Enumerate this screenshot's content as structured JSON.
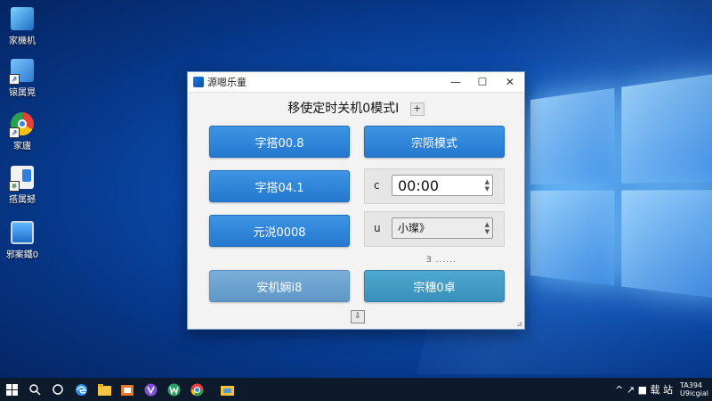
{
  "desktop": {
    "icons": [
      {
        "label": "家機机"
      },
      {
        "label": "锿属晃"
      },
      {
        "label": "家廬"
      },
      {
        "label": "搭属撼"
      },
      {
        "label": "邪案鐵0"
      }
    ]
  },
  "window": {
    "title": "源嗯乐童",
    "controls": {
      "minimize": "—",
      "maximize": "☐",
      "close": "✕"
    },
    "heading": "移使定时关机0模式I",
    "add_label": "+",
    "buttons": {
      "btn1": "字搭00.8",
      "btn2": "宗陨模式",
      "btn3": "字搭04.1",
      "btn4": "元涚0008",
      "btn5": "安机娴i8",
      "btn6": "宗穗0卓"
    },
    "time_field": {
      "label": "c",
      "value": "00:00"
    },
    "mode_field": {
      "label": "u",
      "value": "小璨》"
    },
    "status_text": "Ǝ ......",
    "bottom_icon": "⇩",
    "resize_grip": "⊿"
  },
  "taskbar": {
    "clock": {
      "time": "TA394",
      "date": "U9icgial"
    },
    "tray_text": "^ ↗ ■ 载 站",
    "colors": {
      "bar": "#0c1a2b"
    }
  }
}
